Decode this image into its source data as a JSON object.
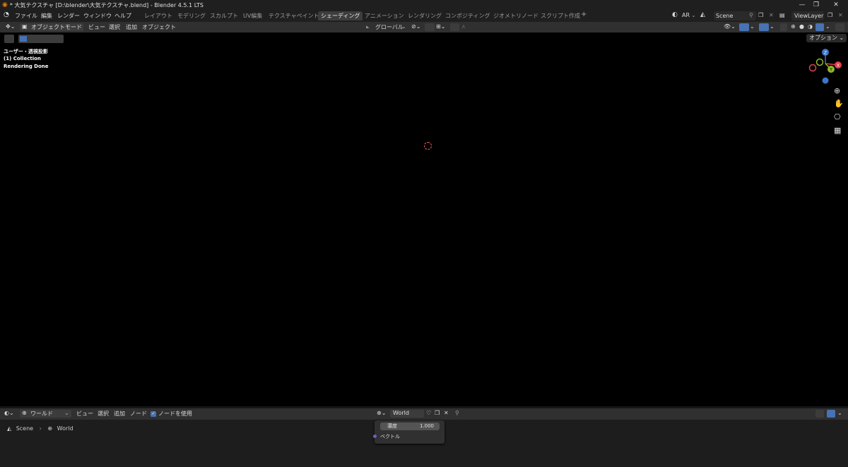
{
  "window": {
    "title": "* 大気テクスチャ [D:\\blender\\大気テクスチャ.blend] - Blender 4.5.1 LTS",
    "controls": [
      "—",
      "❐",
      "✕"
    ]
  },
  "menu": [
    "ファイル",
    "編集",
    "レンダー",
    "ウィンドウ",
    "ヘルプ"
  ],
  "workspaces": [
    "レイアウト",
    "モデリング",
    "スカルプト",
    "UV編集",
    "テクスチャペイント",
    "シェーディング",
    "アニメーション",
    "レンダリング",
    "コンポジティング",
    "ジオメトリノード",
    "スクリプト作成"
  ],
  "active_workspace": "シェーディング",
  "topbar_right": {
    "ar": "AR",
    "scene": "Scene",
    "view_layer": "ViewLayer"
  },
  "viewport_header": {
    "mode": "オブジェクトモード",
    "menus": [
      "ビュー",
      "選択",
      "追加",
      "オブジェクト"
    ],
    "transform_orientation": "グローバル",
    "options": "オプション"
  },
  "viewport_overlay": {
    "view_name": "ユーザー・透視投影",
    "collection": "(1) Collection",
    "status": "Rendering Done"
  },
  "gizmo": {
    "z": "Z",
    "x": "X",
    "y": "Y"
  },
  "node_editor": {
    "world_type": "ワールド",
    "menus": [
      "ビュー",
      "選択",
      "追加",
      "ノード"
    ],
    "use_nodes_label": "ノードを使用",
    "use_nodes": true,
    "world_name": "World",
    "breadcrumb": [
      "Scene",
      "World"
    ]
  },
  "node": {
    "field_label": "濃度",
    "field_value": "1.000",
    "output_label": "ベクトル"
  },
  "colors": {
    "accent_blue": "#4772b3",
    "active_tab": "#3d3d3d",
    "axis_x": "#e2414f",
    "axis_y": "#8bba2d",
    "axis_z": "#3c75c9"
  }
}
